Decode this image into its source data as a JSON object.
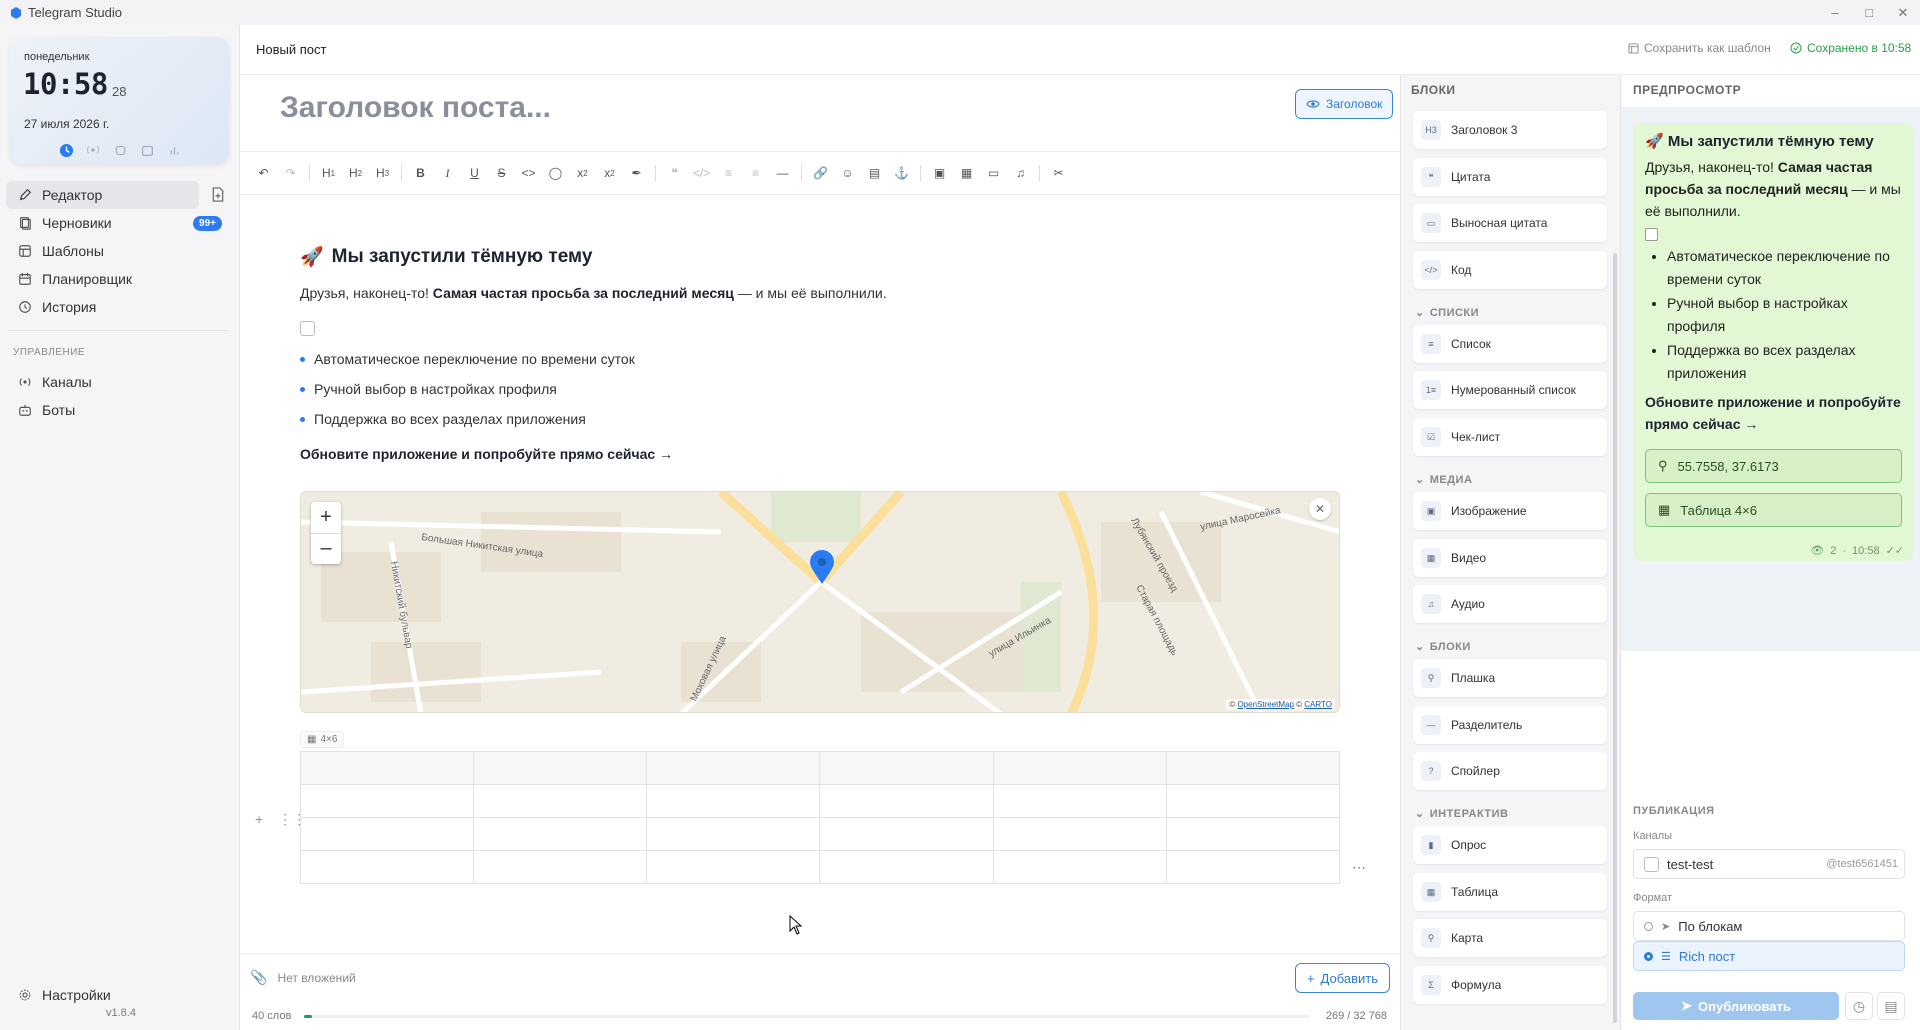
{
  "app": {
    "title": "Telegram Studio",
    "version": "v1.8.4"
  },
  "clock": {
    "weekday": "понедельник",
    "time": "10:58",
    "seconds": "28",
    "date": "27 июля 2026 г."
  },
  "sidebar": {
    "items": [
      {
        "label": "Редактор",
        "icon": "pencil-icon"
      },
      {
        "label": "Черновики",
        "icon": "drafts-icon",
        "badge": "99+"
      },
      {
        "label": "Шаблоны",
        "icon": "templates-icon"
      },
      {
        "label": "Планировщик",
        "icon": "calendar-icon"
      },
      {
        "label": "История",
        "icon": "history-icon"
      }
    ],
    "section_manage": "УПРАВЛЕНИЕ",
    "manage_items": [
      {
        "label": "Каналы",
        "icon": "broadcast-icon"
      },
      {
        "label": "Боты",
        "icon": "bot-icon"
      }
    ],
    "settings_label": "Настройки"
  },
  "topbar": {
    "title": "Новый пост",
    "save_template": "Сохранить как шаблон",
    "saved_status": "Сохранено в 10:58"
  },
  "editor": {
    "title_placeholder": "Заголовок поста...",
    "header_button": "Заголовок",
    "heading_emoji": "🚀",
    "heading": "Мы запустили тёмную тему",
    "para_before": "Друзья, наконец-то! ",
    "para_bold": "Самая частая просьба за последний месяц",
    "para_after": " — и мы её выполнили.",
    "bullets": [
      "Автоматическое переключение по времени суток",
      "Ручной выбор в настройках профиля",
      "Поддержка во всех разделах приложения"
    ],
    "cta": "Обновите приложение и попробуйте прямо сейчас →",
    "map": {
      "attribution_prefix": "© ",
      "attribution_osm": "OpenStreetMap",
      "attribution_sep": " © ",
      "attribution_carto": "CARTO",
      "streets": [
        "Большая Никитская улица",
        "Никитский бульвар",
        "Моховая улица",
        "Лубянский проезд",
        "улица Маросейка",
        "Старая площадь",
        "улица Ильинка"
      ]
    },
    "table_badge": "4×6",
    "table": {
      "rows": 4,
      "cols": 6
    }
  },
  "attachments": {
    "label": "Нет вложений",
    "add_button": "Добавить"
  },
  "status": {
    "words": "40 слов",
    "chars": "269 / 32 768",
    "progress": 0.008
  },
  "blocks": {
    "header": "БЛОКИ",
    "items_top": [
      {
        "label": "Заголовок 3",
        "icon": "H3"
      },
      {
        "label": "Цитата",
        "icon": "quote-icon"
      },
      {
        "label": "Выносная цитата",
        "icon": "pullquote-icon"
      },
      {
        "label": "Код",
        "icon": "code-icon"
      }
    ],
    "group_lists": "СПИСКИ",
    "lists": [
      {
        "label": "Список",
        "icon": "list-icon"
      },
      {
        "label": "Нумерованный список",
        "icon": "numbered-list-icon"
      },
      {
        "label": "Чек-лист",
        "icon": "checklist-icon"
      }
    ],
    "group_media": "МЕДИА",
    "media": [
      {
        "label": "Изображение",
        "icon": "image-icon"
      },
      {
        "label": "Видео",
        "icon": "video-icon"
      },
      {
        "label": "Аудио",
        "icon": "audio-icon"
      }
    ],
    "group_blocks": "БЛОКИ",
    "blocks": [
      {
        "label": "Плашка",
        "icon": "callout-icon"
      },
      {
        "label": "Разделитель",
        "icon": "divider-icon"
      },
      {
        "label": "Спойлер",
        "icon": "spoiler-icon"
      }
    ],
    "group_interactive": "ИНТЕРАКТИВ",
    "interactive": [
      {
        "label": "Опрос",
        "icon": "poll-icon"
      },
      {
        "label": "Таблица",
        "icon": "table-icon"
      },
      {
        "label": "Карта",
        "icon": "map-pin-icon"
      },
      {
        "label": "Формула",
        "icon": "sigma-icon"
      }
    ]
  },
  "preview": {
    "header": "ПРЕДПРОСМОТР",
    "bubble_title": "🚀 Мы запустили тёмную тему",
    "bubble_para_before": "Друзья, наконец-то! ",
    "bubble_para_bold": "Самая частая просьба за последний месяц",
    "bubble_para_after": " — и мы её выполнили.",
    "bubble_bullets": [
      "Автоматическое переключение по времени суток",
      "Ручной выбор в настройках профиля",
      "Поддержка во всех разделах приложения"
    ],
    "bubble_cta": "Обновите приложение и попробуйте прямо сейчас →",
    "map_button": "55.7558, 37.6173",
    "table_button": "Таблица 4×6",
    "views": "2",
    "time": "10:58"
  },
  "publish": {
    "header": "ПУБЛИКАЦИЯ",
    "channels_label": "Каналы",
    "channel_name": "test-test",
    "channel_handle": "@test6561451",
    "format_label": "Формат",
    "format_options": [
      "По блокам",
      "Rich пост"
    ],
    "publish_button": "Опубликовать"
  },
  "colors": {
    "accent": "#2b7cf2",
    "bubble": "#e2f7d3",
    "success": "#24a148"
  }
}
